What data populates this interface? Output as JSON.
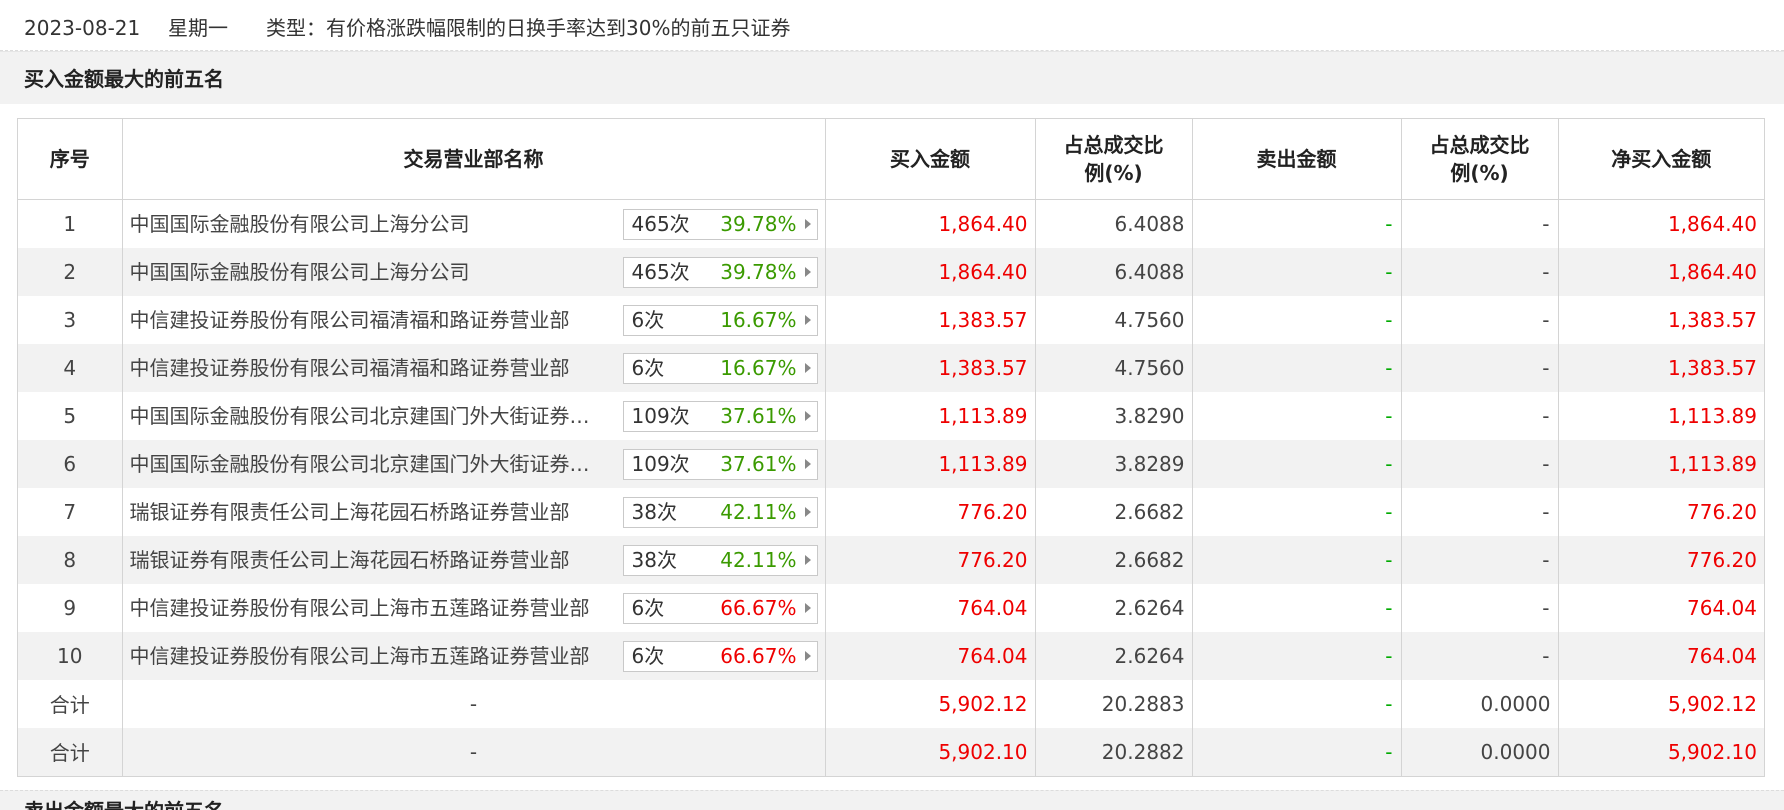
{
  "header": {
    "date": "2023-08-21",
    "weekday": "星期一",
    "type_text": "类型：有价格涨跌幅限制的日换手率达到30%的前五只证券"
  },
  "section": {
    "title": "买入金额最大的前五名"
  },
  "next_section": {
    "title": "卖出金额最大的前五名"
  },
  "table": {
    "headers": {
      "seq": "序号",
      "name": "交易营业部名称",
      "buy": "买入金额",
      "buy_pct_line1": "占总成交比",
      "buy_pct_line2": "例(%)",
      "sell": "卖出金额",
      "sell_pct_line1": "占总成交比",
      "sell_pct_line2": "例(%)",
      "net": "净买入金额"
    },
    "rows": [
      {
        "seq": "1",
        "name": "中国国际金融股份有限公司上海分公司",
        "count": "465次",
        "rate": "39.78%",
        "rate_color": "#3a9a00",
        "buy": "1,864.40",
        "buy_pct": "6.4088",
        "sell": "-",
        "sell_pct": "-",
        "net": "1,864.40"
      },
      {
        "seq": "2",
        "name": "中国国际金融股份有限公司上海分公司",
        "count": "465次",
        "rate": "39.78%",
        "rate_color": "#3a9a00",
        "buy": "1,864.40",
        "buy_pct": "6.4088",
        "sell": "-",
        "sell_pct": "-",
        "net": "1,864.40"
      },
      {
        "seq": "3",
        "name": "中信建投证券股份有限公司福清福和路证券营业部",
        "count": "6次",
        "rate": "16.67%",
        "rate_color": "#3a9a00",
        "buy": "1,383.57",
        "buy_pct": "4.7560",
        "sell": "-",
        "sell_pct": "-",
        "net": "1,383.57"
      },
      {
        "seq": "4",
        "name": "中信建投证券股份有限公司福清福和路证券营业部",
        "count": "6次",
        "rate": "16.67%",
        "rate_color": "#3a9a00",
        "buy": "1,383.57",
        "buy_pct": "4.7560",
        "sell": "-",
        "sell_pct": "-",
        "net": "1,383.57"
      },
      {
        "seq": "5",
        "name": "中国国际金融股份有限公司北京建国门外大街证券…",
        "count": "109次",
        "rate": "37.61%",
        "rate_color": "#3a9a00",
        "buy": "1,113.89",
        "buy_pct": "3.8290",
        "sell": "-",
        "sell_pct": "-",
        "net": "1,113.89"
      },
      {
        "seq": "6",
        "name": "中国国际金融股份有限公司北京建国门外大街证券…",
        "count": "109次",
        "rate": "37.61%",
        "rate_color": "#3a9a00",
        "buy": "1,113.89",
        "buy_pct": "3.8289",
        "sell": "-",
        "sell_pct": "-",
        "net": "1,113.89"
      },
      {
        "seq": "7",
        "name": "瑞银证券有限责任公司上海花园石桥路证券营业部",
        "count": "38次",
        "rate": "42.11%",
        "rate_color": "#3a9a00",
        "buy": "776.20",
        "buy_pct": "2.6682",
        "sell": "-",
        "sell_pct": "-",
        "net": "776.20"
      },
      {
        "seq": "8",
        "name": "瑞银证券有限责任公司上海花园石桥路证券营业部",
        "count": "38次",
        "rate": "42.11%",
        "rate_color": "#3a9a00",
        "buy": "776.20",
        "buy_pct": "2.6682",
        "sell": "-",
        "sell_pct": "-",
        "net": "776.20"
      },
      {
        "seq": "9",
        "name": "中信建投证券股份有限公司上海市五莲路证券营业部",
        "count": "6次",
        "rate": "66.67%",
        "rate_color": "#ee0000",
        "buy": "764.04",
        "buy_pct": "2.6264",
        "sell": "-",
        "sell_pct": "-",
        "net": "764.04"
      },
      {
        "seq": "10",
        "name": "中信建投证券股份有限公司上海市五莲路证券营业部",
        "count": "6次",
        "rate": "66.67%",
        "rate_color": "#ee0000",
        "buy": "764.04",
        "buy_pct": "2.6264",
        "sell": "-",
        "sell_pct": "-",
        "net": "764.04"
      }
    ],
    "totals": [
      {
        "label": "合计",
        "name": "-",
        "buy": "5,902.12",
        "buy_pct": "20.2883",
        "sell": "-",
        "sell_pct": "0.0000",
        "net": "5,902.12"
      },
      {
        "label": "合计",
        "name": "-",
        "buy": "5,902.10",
        "buy_pct": "20.2882",
        "sell": "-",
        "sell_pct": "0.0000",
        "net": "5,902.10"
      }
    ]
  }
}
